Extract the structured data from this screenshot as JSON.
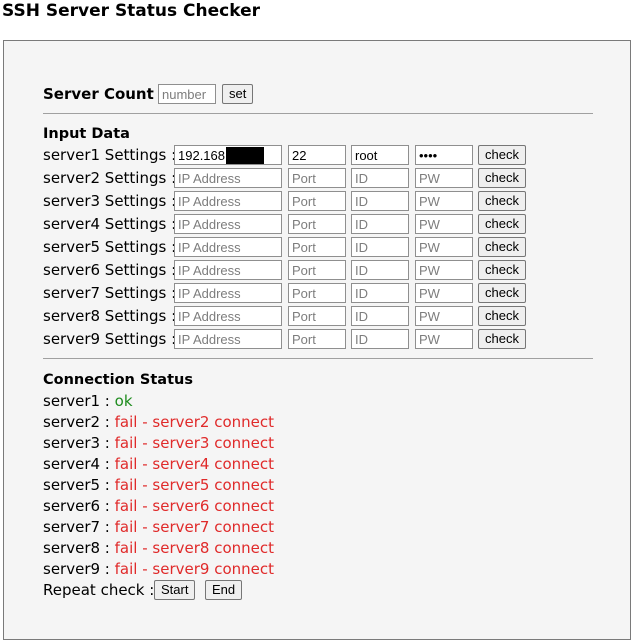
{
  "title": "SSH Server Status Checker",
  "server_count": {
    "label": "Server Count :",
    "placeholder": "number",
    "button": "set"
  },
  "input_data": {
    "heading": "Input Data",
    "check_label": "check",
    "placeholders": {
      "ip": "IP Address",
      "port": "Port",
      "id": "ID",
      "pw": "PW"
    },
    "servers": [
      {
        "label": "server1 Settings :",
        "ip": "192.168",
        "port": "22",
        "id": "root",
        "pw": "••••"
      },
      {
        "label": "server2 Settings :",
        "ip": "",
        "port": "",
        "id": "",
        "pw": ""
      },
      {
        "label": "server3 Settings :",
        "ip": "",
        "port": "",
        "id": "",
        "pw": ""
      },
      {
        "label": "server4 Settings :",
        "ip": "",
        "port": "",
        "id": "",
        "pw": ""
      },
      {
        "label": "server5 Settings :",
        "ip": "",
        "port": "",
        "id": "",
        "pw": ""
      },
      {
        "label": "server6 Settings :",
        "ip": "",
        "port": "",
        "id": "",
        "pw": ""
      },
      {
        "label": "server7 Settings :",
        "ip": "",
        "port": "",
        "id": "",
        "pw": ""
      },
      {
        "label": "server8 Settings :",
        "ip": "",
        "port": "",
        "id": "",
        "pw": ""
      },
      {
        "label": "server9 Settings :",
        "ip": "",
        "port": "",
        "id": "",
        "pw": ""
      }
    ]
  },
  "connection_status": {
    "heading": "Connection Status",
    "items": [
      {
        "label": "server1 :",
        "status": "ok",
        "state": "ok"
      },
      {
        "label": "server2 :",
        "status": "fail - server2 connect",
        "state": "fail"
      },
      {
        "label": "server3 :",
        "status": "fail - server3 connect",
        "state": "fail"
      },
      {
        "label": "server4 :",
        "status": "fail - server4 connect",
        "state": "fail"
      },
      {
        "label": "server5 :",
        "status": "fail - server5 connect",
        "state": "fail"
      },
      {
        "label": "server6 :",
        "status": "fail - server6 connect",
        "state": "fail"
      },
      {
        "label": "server7 :",
        "status": "fail - server7 connect",
        "state": "fail"
      },
      {
        "label": "server8 :",
        "status": "fail - server8 connect",
        "state": "fail"
      },
      {
        "label": "server9 :",
        "status": "fail - server9 connect",
        "state": "fail"
      }
    ],
    "ok_color": "#1e8c1e",
    "fail_color": "#e02a2a"
  },
  "repeat_check": {
    "label": "Repeat check :",
    "start": "Start",
    "end": "End"
  }
}
